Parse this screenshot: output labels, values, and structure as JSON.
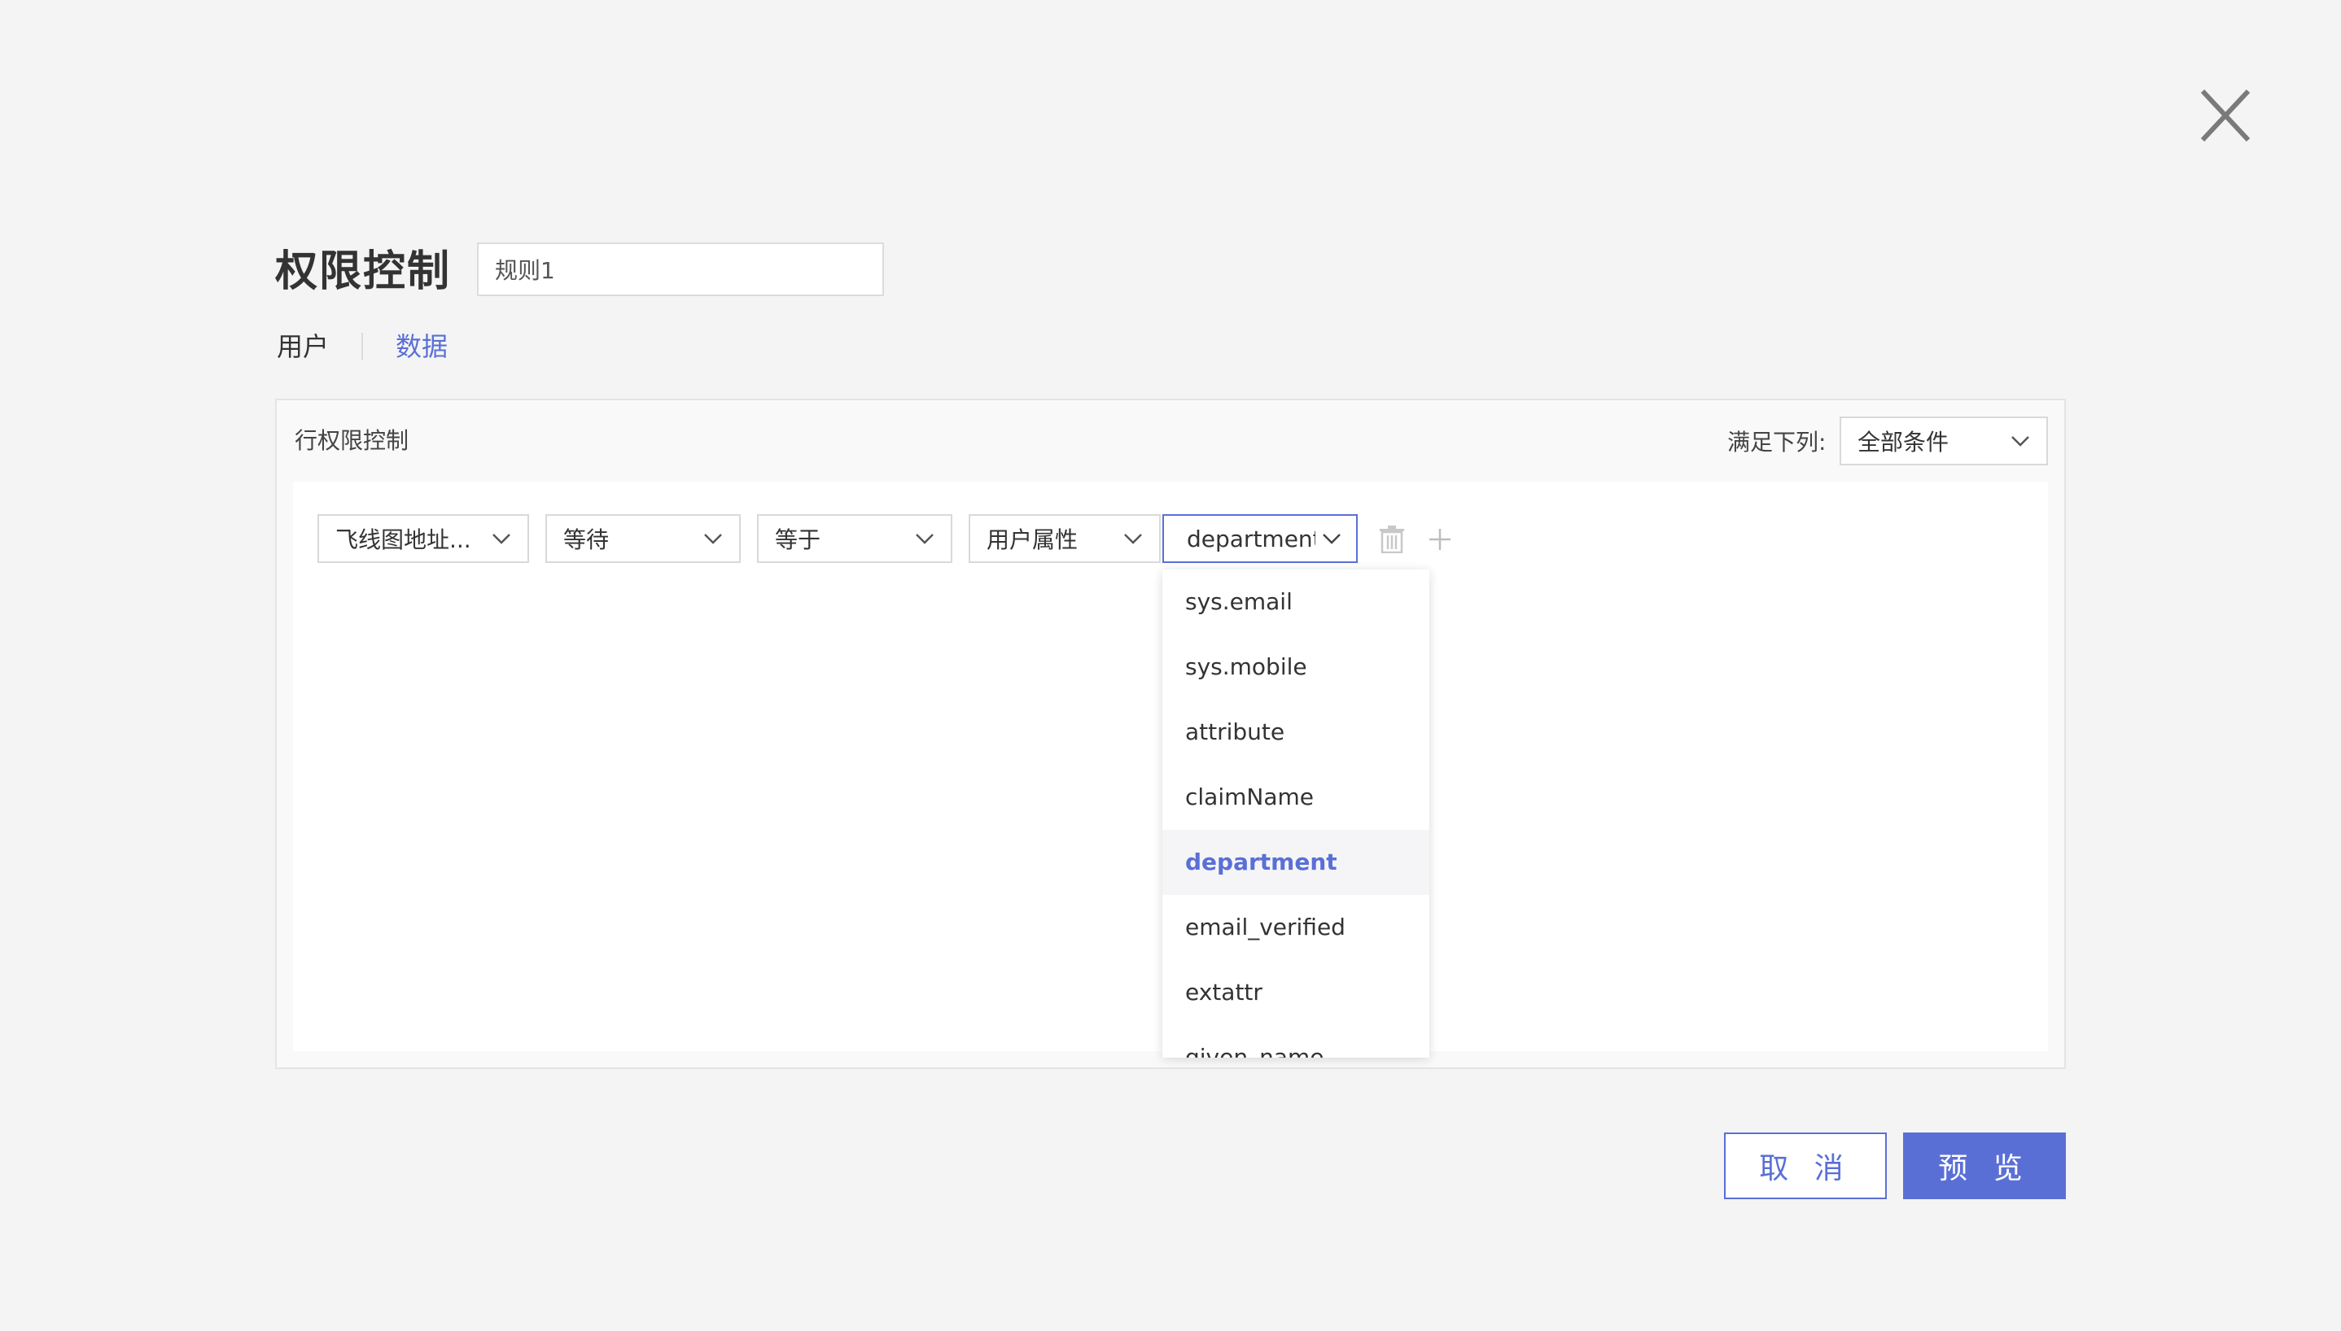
{
  "header": {
    "title": "权限控制",
    "rule_name_value": "规则1"
  },
  "tabs": [
    {
      "label": "用户",
      "active": false
    },
    {
      "label": "数据",
      "active": true
    }
  ],
  "panel": {
    "title": "行权限控制",
    "satisfy_label": "满足下列:",
    "satisfy_value": "全部条件"
  },
  "condition": {
    "field": "飞线图地址...",
    "wait": "等待",
    "operator": "等于",
    "source": "用户属性",
    "attribute": "department"
  },
  "dropdown": {
    "options": [
      "sys.email",
      "sys.mobile",
      "attribute",
      "claimName",
      "department",
      "email_verified",
      "extattr",
      "given_name"
    ],
    "selected": "department"
  },
  "footer": {
    "cancel_label": "取 消",
    "preview_label": "预 览"
  },
  "colors": {
    "accent": "#5a6fd6",
    "background": "#f4f4f4"
  },
  "icons": {
    "close": "close-icon",
    "chevron": "chevron-down-icon",
    "delete": "trash-icon",
    "add": "plus-icon"
  }
}
